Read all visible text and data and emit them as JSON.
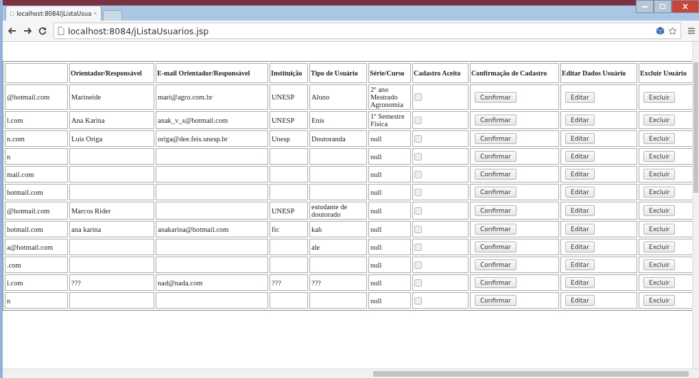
{
  "tab": {
    "title": "localhost:8084/jListaUsua"
  },
  "address_bar": {
    "value": "localhost:8084/jListaUsuarios.jsp"
  },
  "table": {
    "columns": [
      "Orientador/Responsável",
      "E-mail Orientador/Responsável",
      "Instituição",
      "Tipo de Usuário",
      "Série/Curso",
      "Cadastro Aceito",
      "Confirmação de Cadastro",
      "Editar Dados Usuário",
      "Excluir Usuário"
    ],
    "rows": [
      {
        "column_1": "@hotmail.com",
        "orientador": "Marineide",
        "email_orientador": "mari@agro.com.br",
        "instituicao": "UNESP",
        "tipo": "Aluno",
        "serie": "2º ano Mestrado Agronomia",
        "checked": false,
        "confirm": "Confirmar",
        "edit": "Editar",
        "delete": "Excluir"
      },
      {
        "column_1": "l.com",
        "orientador": "Ana Karina",
        "email_orientador": "anak_v_s@hotmail.com",
        "instituicao": "UNESP",
        "tipo": "Enis",
        "serie": "1º Semestre Física",
        "checked": false,
        "confirm": "Confirmar",
        "edit": "Editar",
        "delete": "Excluir"
      },
      {
        "column_1": "n.com",
        "orientador": "Luis Origa",
        "email_orientador": "origa@dee.feis.unesp.br",
        "instituicao": "Unesp",
        "tipo": "Doutoranda",
        "serie": "null",
        "checked": false,
        "confirm": "Confirmar",
        "edit": "Editar",
        "delete": "Excluir"
      },
      {
        "column_1": "n",
        "serie": "null",
        "checked": false,
        "confirm": "Confirmar",
        "edit": "Editar",
        "delete": "Excluir"
      },
      {
        "column_1": "mail.com",
        "serie": "null",
        "checked": false,
        "confirm": "Confirmar",
        "edit": "Editar",
        "delete": "Excluir"
      },
      {
        "column_1": "hotmail.com",
        "serie": "null",
        "checked": false,
        "confirm": "Confirmar",
        "edit": "Editar",
        "delete": "Excluir"
      },
      {
        "column_1": "@hotmail.com",
        "orientador": "Marcos Rider",
        "instituicao": "UNESP",
        "tipo": "estudante de doutorado",
        "serie": "null",
        "checked": false,
        "confirm": "Confirmar",
        "edit": "Editar",
        "delete": "Excluir"
      },
      {
        "column_1": "hotmail.com",
        "orientador": "ana karina",
        "email_orientador": "anakarina@hotmail.com",
        "instituicao": "fic",
        "tipo": "kah",
        "serie": "null",
        "checked": false,
        "confirm": "Confirmar",
        "edit": "Editar",
        "delete": "Excluir"
      },
      {
        "column_1": "a@hotmail.com",
        "tipo": "ale",
        "serie": "null",
        "checked": false,
        "confirm": "Confirmar",
        "edit": "Editar",
        "delete": "Excluir"
      },
      {
        "column_1": ".com",
        "serie": "null",
        "checked": false,
        "confirm": "Confirmar",
        "edit": "Editar",
        "delete": "Excluir"
      },
      {
        "column_1": "l.com",
        "orientador": "???",
        "email_orientador": "nad@nada.com",
        "instituicao": "???",
        "tipo": "???",
        "serie": "null",
        "checked": false,
        "confirm": "Confirmar",
        "edit": "Editar",
        "delete": "Excluir"
      },
      {
        "column_1": "n",
        "serie": "null",
        "checked": false,
        "confirm": "Confirmar",
        "edit": "Editar",
        "delete": "Excluir"
      }
    ]
  }
}
